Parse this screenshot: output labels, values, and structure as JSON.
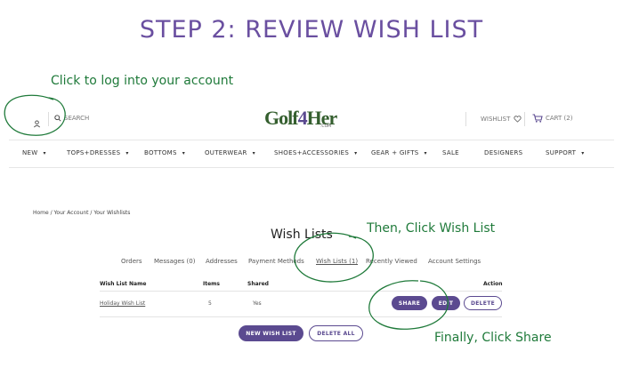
{
  "instructions": {
    "title": "STEP 2: REVIEW WISH LIST",
    "note_login": "Click to log into your account",
    "note_wishlist": "Then, Click Wish List",
    "note_share": "Finally, Click Share"
  },
  "header": {
    "search_placeholder": "SEARCH",
    "logo_left": "Golf",
    "logo_mid": "4",
    "logo_right": "Her",
    "logo_sub": ".COM",
    "wishlist_label": "WISHLIST",
    "cart_label": "CART (2)"
  },
  "nav": {
    "items": [
      {
        "label": "NEW",
        "caret": true
      },
      {
        "label": "TOPS+DRESSES",
        "caret": true
      },
      {
        "label": "BOTTOMS",
        "caret": true
      },
      {
        "label": "OUTERWEAR",
        "caret": true
      },
      {
        "label": "SHOES+ACCESSORIES",
        "caret": true
      },
      {
        "label": "GEAR + GIFTS",
        "caret": true
      },
      {
        "label": "SALE",
        "caret": false
      },
      {
        "label": "DESIGNERS",
        "caret": false
      },
      {
        "label": "SUPPORT",
        "caret": true
      }
    ]
  },
  "breadcrumb": "Home / Your Account / Your Wishlists",
  "wishlists": {
    "title": "Wish Lists",
    "tabs": [
      "Orders",
      "Messages (0)",
      "Addresses",
      "Payment Methods",
      "Wish Lists (1)",
      "Recently Viewed",
      "Account Settings"
    ],
    "columns": [
      "Wish List Name",
      "Items",
      "Shared",
      "Action"
    ],
    "rows": [
      {
        "name": "Holiday Wish List",
        "items": "5",
        "shared": "Yes"
      }
    ],
    "share_label": "SHARE",
    "edit_label": "EDIT",
    "delete_label": "DELETE",
    "new_label": "NEW WISH LIST",
    "delete_all_label": "DELETE ALL"
  },
  "colors": {
    "brand_purple": "#5b4a90",
    "annotation_green": "#1f7a3a",
    "title_purple": "#6a4fa0"
  },
  "icons": [
    "user-icon",
    "search-icon",
    "heart-icon",
    "cart-icon",
    "chevron-down-icon"
  ]
}
